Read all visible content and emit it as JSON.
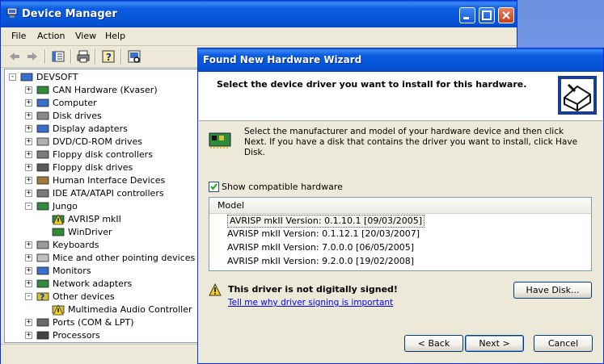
{
  "device_manager": {
    "title": "Device Manager",
    "menu": [
      "File",
      "Action",
      "View",
      "Help"
    ],
    "toolbar_icons": [
      "back-arrow-icon",
      "forward-arrow-icon",
      "properties-icon",
      "print-icon",
      "help-icon",
      "scan-hardware-icon"
    ],
    "tree": [
      {
        "label": "DEVSOFT",
        "level": 0,
        "expander": "-",
        "icon": "computer-icon"
      },
      {
        "label": "CAN Hardware (Kvaser)",
        "level": 1,
        "expander": "+",
        "icon": "card-icon"
      },
      {
        "label": "Computer",
        "level": 1,
        "expander": "+",
        "icon": "monitor-icon"
      },
      {
        "label": "Disk drives",
        "level": 1,
        "expander": "+",
        "icon": "disk-icon"
      },
      {
        "label": "Display adapters",
        "level": 1,
        "expander": "+",
        "icon": "display-icon"
      },
      {
        "label": "DVD/CD-ROM drives",
        "level": 1,
        "expander": "+",
        "icon": "cdrom-icon"
      },
      {
        "label": "Floppy disk controllers",
        "level": 1,
        "expander": "+",
        "icon": "controller-icon"
      },
      {
        "label": "Floppy disk drives",
        "level": 1,
        "expander": "+",
        "icon": "floppy-icon"
      },
      {
        "label": "Human Interface Devices",
        "level": 1,
        "expander": "+",
        "icon": "hid-icon"
      },
      {
        "label": "IDE ATA/ATAPI controllers",
        "level": 1,
        "expander": "+",
        "icon": "ide-icon"
      },
      {
        "label": "Jungo",
        "level": 1,
        "expander": "-",
        "icon": "card-icon"
      },
      {
        "label": "AVRISP mkII",
        "level": 2,
        "expander": "",
        "icon": "warning-card-icon"
      },
      {
        "label": "WinDriver",
        "level": 2,
        "expander": "",
        "icon": "card-icon"
      },
      {
        "label": "Keyboards",
        "level": 1,
        "expander": "+",
        "icon": "keyboard-icon"
      },
      {
        "label": "Mice and other pointing devices",
        "level": 1,
        "expander": "+",
        "icon": "mouse-icon"
      },
      {
        "label": "Monitors",
        "level": 1,
        "expander": "+",
        "icon": "monitor-icon"
      },
      {
        "label": "Network adapters",
        "level": 1,
        "expander": "+",
        "icon": "network-icon"
      },
      {
        "label": "Other devices",
        "level": 1,
        "expander": "-",
        "icon": "question-icon"
      },
      {
        "label": "Multimedia Audio Controller",
        "level": 2,
        "expander": "",
        "icon": "question-warning-icon"
      },
      {
        "label": "Ports (COM & LPT)",
        "level": 1,
        "expander": "+",
        "icon": "port-icon"
      },
      {
        "label": "Processors",
        "level": 1,
        "expander": "+",
        "icon": "processor-icon"
      }
    ]
  },
  "wizard": {
    "title": "Found New Hardware Wizard",
    "header": "Select the device driver you want to install for this hardware.",
    "instructions": "Select the manufacturer and model of your hardware device and then click Next. If you have a disk that contains the driver you want to install, click Have Disk.",
    "show_compatible_label": "Show compatible hardware",
    "show_compatible_checked": true,
    "list_header": "Model",
    "models": [
      "AVRISP mkII Version: 0.1.10.1 [09/03/2005]",
      "AVRISP mkII Version: 0.1.12.1 [20/03/2007]",
      "AVRISP mkII Version: 7.0.0.0 [06/05/2005]",
      "AVRISP mkII Version: 9.2.0.0 [19/02/2008]"
    ],
    "selected_model_index": 0,
    "warning": "This driver is not digitally signed!",
    "warning_link": "Tell me why driver signing is important",
    "buttons": {
      "have_disk": "Have Disk...",
      "back": "< Back",
      "next": "Next >",
      "cancel": "Cancel"
    }
  }
}
